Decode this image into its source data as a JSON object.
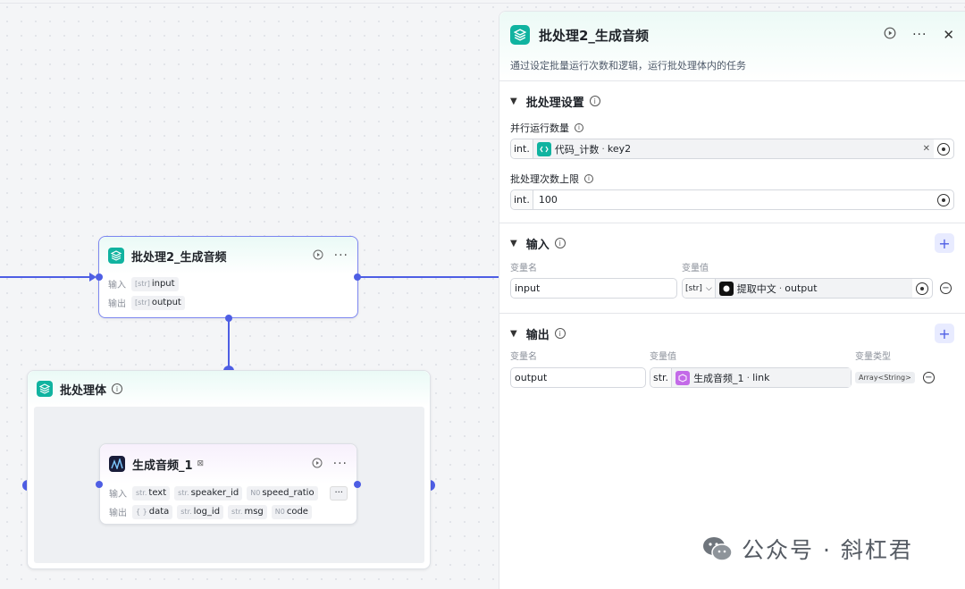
{
  "canvas": {
    "batch_node": {
      "title": "批处理2_生成音频",
      "input_label": "输入",
      "output_label": "输出",
      "input_type": "[str]",
      "input_var": "input",
      "output_type": "[str]",
      "output_var": "output"
    },
    "batch_body": {
      "title": "批处理体"
    },
    "audio_node": {
      "title": "生成音频_1",
      "input_label": "输入",
      "output_label": "输出",
      "inputs": [
        {
          "type": "str.",
          "name": "text"
        },
        {
          "type": "str.",
          "name": "speaker_id"
        },
        {
          "type": "N0",
          "name": "speed_ratio"
        }
      ],
      "outputs": [
        {
          "type": "{ }",
          "name": "data"
        },
        {
          "type": "str.",
          "name": "log_id"
        },
        {
          "type": "str.",
          "name": "msg"
        },
        {
          "type": "N0",
          "name": "code"
        }
      ]
    }
  },
  "panel": {
    "title": "批处理2_生成音频",
    "description": "通过设定批量运行次数和逻辑，运行批处理体内的任务",
    "settings": {
      "heading": "批处理设置",
      "parallel_label": "并行运行数量",
      "parallel_type": "int.",
      "parallel_ref_source": "代码_计数",
      "parallel_ref_key": "key2",
      "limit_label": "批处理次数上限",
      "limit_type": "int.",
      "limit_value": "100"
    },
    "inputs": {
      "heading": "输入",
      "col_name": "变量名",
      "col_value": "变量值",
      "row_name": "input",
      "row_type": "[str]",
      "row_ref_source": "提取中文",
      "row_ref_key": "output"
    },
    "outputs": {
      "heading": "输出",
      "col_name": "变量名",
      "col_value": "变量值",
      "col_type": "变量类型",
      "row_name": "output",
      "row_type": "str.",
      "row_ref_source": "生成音频_1",
      "row_ref_key": "link",
      "row_var_type": "Array<String>"
    }
  },
  "watermark": {
    "text": "公众号 · 斜杠君"
  },
  "colors": {
    "accent": "#4e5ee4",
    "teal": "#10b3a0"
  }
}
